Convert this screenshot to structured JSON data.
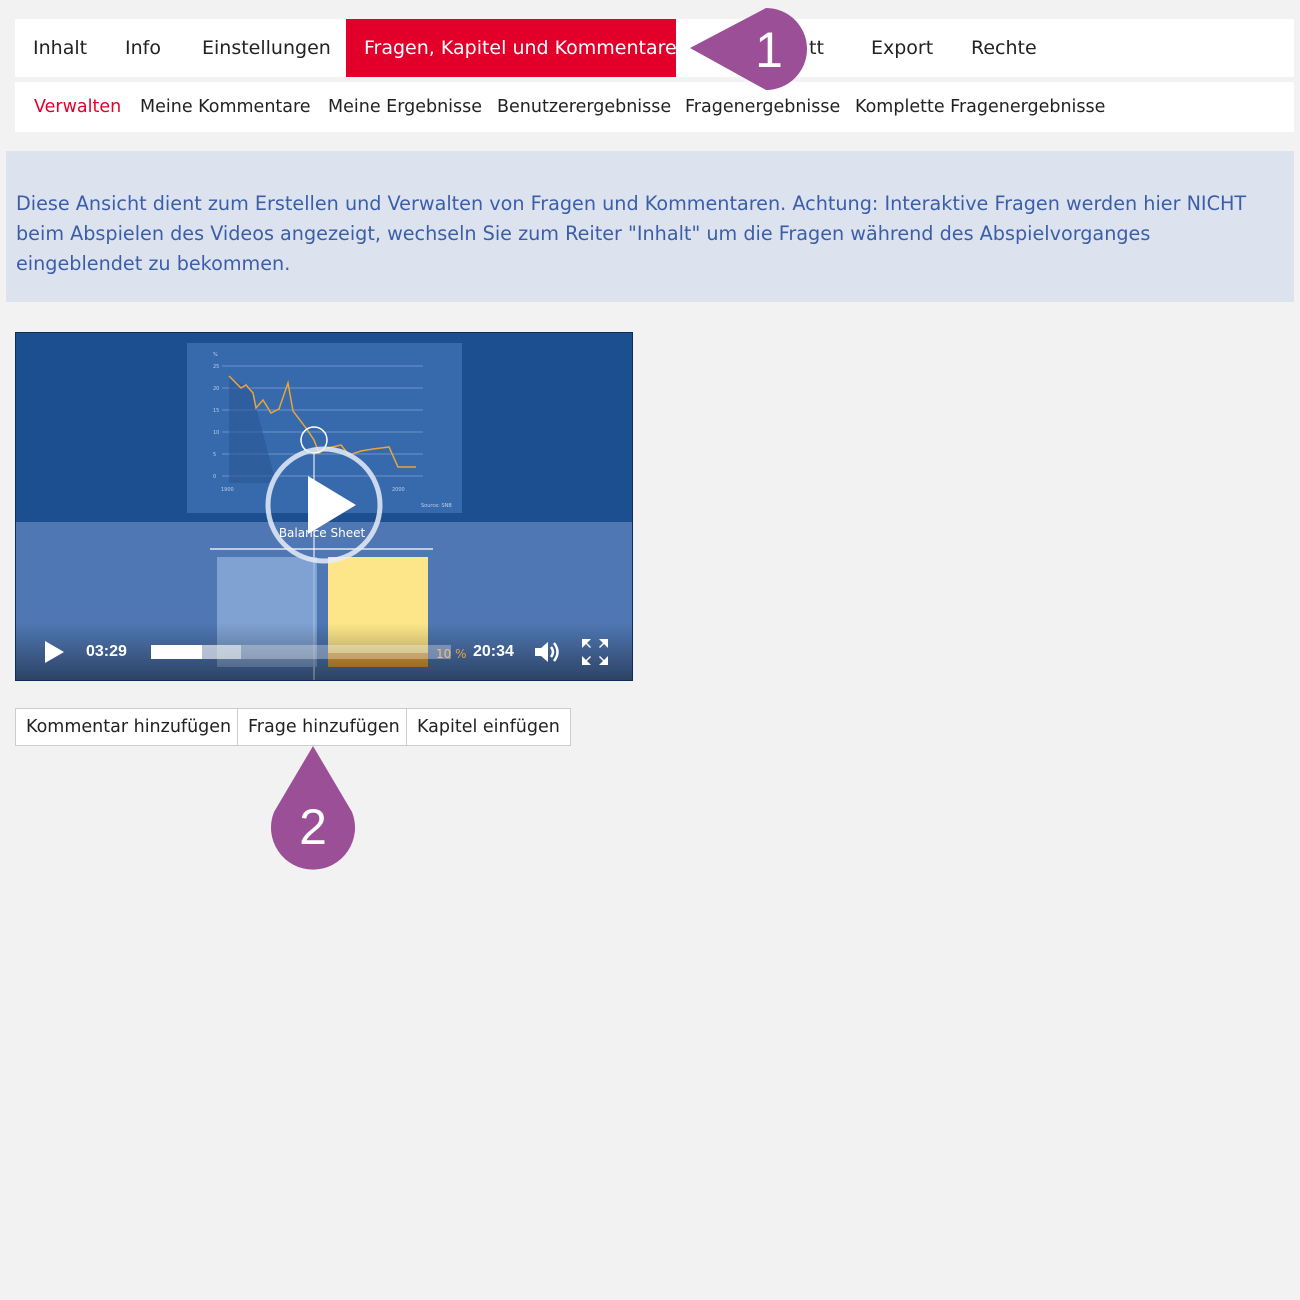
{
  "tabs": [
    {
      "label": "Inhalt",
      "active": false
    },
    {
      "label": "Info",
      "active": false
    },
    {
      "label": "Einstellungen",
      "active": false
    },
    {
      "label": "Fragen, Kapitel und Kommentare",
      "active": true
    },
    {
      "label": "tt",
      "active": false
    },
    {
      "label": "Export",
      "active": false
    },
    {
      "label": "Rechte",
      "active": false
    }
  ],
  "subtabs": [
    {
      "label": "Verwalten",
      "active": true
    },
    {
      "label": "Meine Kommentare",
      "active": false
    },
    {
      "label": "Meine Ergebnisse",
      "active": false
    },
    {
      "label": "Benutzerergebnisse",
      "active": false
    },
    {
      "label": "Fragenergebnisse",
      "active": false
    },
    {
      "label": "Komplette Fragenergebnisse",
      "active": false
    }
  ],
  "info_text": "Diese Ansicht dient zum Erstellen und Verwalten von Fragen und Kommentaren. Achtung: Interaktive Fragen werden hier NICHT beim Abspielen des Videos angezeigt, wechseln Sie zum Reiter \"Inhalt\" um die Fragen während des Abspielvorganges eingeblendet zu bekommen.",
  "video": {
    "current_time": "03:29",
    "duration": "20:34",
    "progress": 0.17,
    "buffered": 0.3,
    "slide_title": "Balance Sheet",
    "slide_source": "Source: SNB",
    "slide_percent": "10 %",
    "chart_axis_y": [
      "%",
      "25",
      "20",
      "15",
      "10",
      "5",
      "0"
    ],
    "chart_axis_x": [
      "1900",
      "2000"
    ]
  },
  "buttons": {
    "add_comment": "Kommentar hinzufügen",
    "add_question": "Frage hinzufügen",
    "insert_chapter": "Kapitel einfügen"
  },
  "markers": {
    "first": "1",
    "second": "2"
  },
  "colors": {
    "accent": "#e2002a",
    "marker": "#9b4f96",
    "info_bg": "#dce3ef",
    "info_text": "#3b5ea8"
  }
}
